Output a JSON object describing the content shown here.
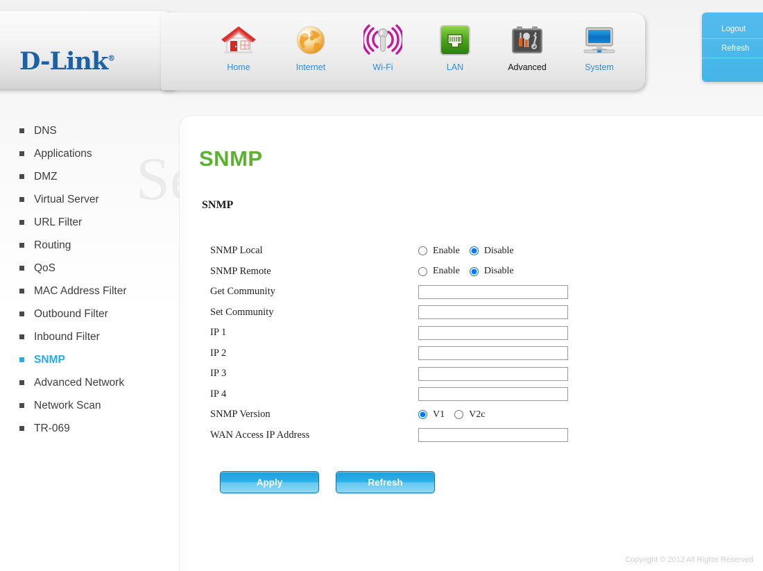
{
  "brand": {
    "name": "D-Link",
    "registered": "®"
  },
  "nav": {
    "items": [
      {
        "label": "Home",
        "icon": "house-icon",
        "active": false
      },
      {
        "label": "Internet",
        "icon": "globe-icon",
        "active": false
      },
      {
        "label": "Wi-Fi",
        "icon": "wifi-icon",
        "active": false
      },
      {
        "label": "LAN",
        "icon": "ethernet-port-icon",
        "active": false
      },
      {
        "label": "Advanced",
        "icon": "toolbox-icon",
        "active": true
      },
      {
        "label": "System",
        "icon": "monitor-icon",
        "active": false
      }
    ]
  },
  "side_panel": {
    "logout": "Logout",
    "refresh": "Refresh"
  },
  "sidebar": {
    "items": [
      {
        "label": "DNS"
      },
      {
        "label": "Applications"
      },
      {
        "label": "DMZ"
      },
      {
        "label": "Virtual Server"
      },
      {
        "label": "URL Filter"
      },
      {
        "label": "Routing"
      },
      {
        "label": "QoS"
      },
      {
        "label": "MAC Address Filter"
      },
      {
        "label": "Outbound Filter"
      },
      {
        "label": "Inbound Filter"
      },
      {
        "label": "SNMP"
      },
      {
        "label": "Advanced Network"
      },
      {
        "label": "Network Scan"
      },
      {
        "label": "TR-069"
      }
    ],
    "active_index": 10
  },
  "main": {
    "page_title": "SNMP",
    "section_title": "SNMP",
    "rows": {
      "snmp_local": {
        "label": "SNMP Local",
        "options": [
          "Enable",
          "Disable"
        ],
        "selected": "Disable"
      },
      "snmp_remote": {
        "label": "SNMP Remote",
        "options": [
          "Enable",
          "Disable"
        ],
        "selected": "Disable"
      },
      "get_community": {
        "label": "Get Community",
        "value": "",
        "placeholder": ""
      },
      "set_community": {
        "label": "Set Community",
        "value": "",
        "placeholder": ""
      },
      "ip1": {
        "label": "IP 1",
        "value": "",
        "placeholder": ""
      },
      "ip2": {
        "label": "IP 2",
        "value": "",
        "placeholder": ""
      },
      "ip3": {
        "label": "IP 3",
        "value": "",
        "placeholder": ""
      },
      "ip4": {
        "label": "IP 4",
        "value": "",
        "placeholder": ""
      },
      "snmp_version": {
        "label": "SNMP Version",
        "options": [
          "V1",
          "V2c"
        ],
        "selected": "V1"
      },
      "wan_access_ip": {
        "label": "WAN Access IP Address",
        "value": "",
        "placeholder": ""
      }
    },
    "buttons": {
      "apply": "Apply",
      "refresh": "Refresh"
    }
  },
  "watermark": {
    "text": "SetupRouter.com"
  },
  "footer": {
    "copyright": "Copyright © 2012  All Rights Reserved"
  },
  "colors": {
    "brand_blue": "#1b61a6",
    "accent_cyan": "#29abe2",
    "title_green": "#5cb130",
    "nav_link": "#2e8fd8"
  }
}
